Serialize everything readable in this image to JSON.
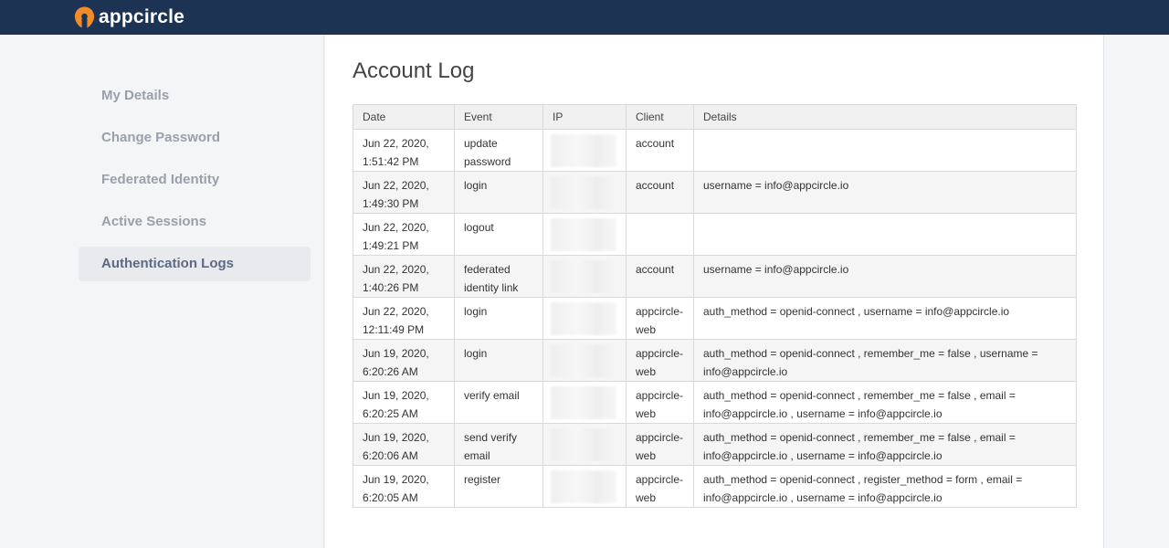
{
  "app": {
    "name": "appcircle",
    "brand_color": "#f08c2a",
    "header_color": "#1c3354"
  },
  "sidebar": {
    "items": [
      {
        "label": "My Details",
        "active": false
      },
      {
        "label": "Change Password",
        "active": false
      },
      {
        "label": "Federated Identity",
        "active": false
      },
      {
        "label": "Active Sessions",
        "active": false
      },
      {
        "label": "Authentication Logs",
        "active": true
      }
    ]
  },
  "main": {
    "title": "Account Log",
    "table": {
      "headers": [
        "Date",
        "Event",
        "IP",
        "Client",
        "Details"
      ],
      "rows": [
        {
          "date": "Jun 22, 2020, 1:51:42 PM",
          "event": "update password",
          "ip": "",
          "client": "account",
          "details": ""
        },
        {
          "date": "Jun 22, 2020, 1:49:30 PM",
          "event": "login",
          "ip": "",
          "client": "account",
          "details": "username = info@appcircle.io"
        },
        {
          "date": "Jun 22, 2020, 1:49:21 PM",
          "event": "logout",
          "ip": "",
          "client": "",
          "details": ""
        },
        {
          "date": "Jun 22, 2020, 1:40:26 PM",
          "event": "federated identity link",
          "ip": "",
          "client": "account",
          "details": "username = info@appcircle.io"
        },
        {
          "date": "Jun 22, 2020, 12:11:49 PM",
          "event": "login",
          "ip": "",
          "client": "appcircle-web",
          "details": "auth_method = openid-connect , username = info@appcircle.io"
        },
        {
          "date": "Jun 19, 2020, 6:20:26 AM",
          "event": "login",
          "ip": "",
          "client": "appcircle-web",
          "details": "auth_method = openid-connect , remember_me = false , username = info@appcircle.io"
        },
        {
          "date": "Jun 19, 2020, 6:20:25 AM",
          "event": "verify email",
          "ip": "",
          "client": "appcircle-web",
          "details": "auth_method = openid-connect , remember_me = false , email = info@appcircle.io , username = info@appcircle.io"
        },
        {
          "date": "Jun 19, 2020, 6:20:06 AM",
          "event": "send verify email",
          "ip": "",
          "client": "appcircle-web",
          "details": "auth_method = openid-connect , remember_me = false , email = info@appcircle.io , username = info@appcircle.io"
        },
        {
          "date": "Jun 19, 2020, 6:20:05 AM",
          "event": "register",
          "ip": "",
          "client": "appcircle-web",
          "details": "auth_method = openid-connect , register_method = form , email = info@appcircle.io , username = info@appcircle.io"
        }
      ]
    }
  }
}
